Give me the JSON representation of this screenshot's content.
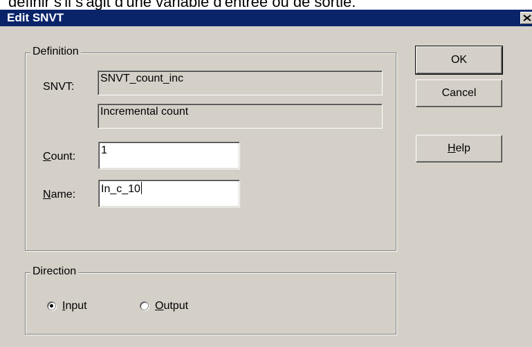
{
  "background_text": "définir s'il s'agit d'une variable d'entrée ou de sortie.",
  "dialog": {
    "title": "Edit SNVT",
    "buttons": {
      "ok": "OK",
      "cancel": "Cancel",
      "help_mnemonic": "H",
      "help_rest": "elp"
    }
  },
  "definition": {
    "legend": "Definition",
    "snvt_label": "SNVT:",
    "snvt_name": "SNVT_count_inc",
    "snvt_description": "Incremental count",
    "count_label_mnemonic": "C",
    "count_label_rest": "ount:",
    "count_value": "1",
    "name_label_mnemonic": "N",
    "name_label_rest": "ame:",
    "name_value": "In_c_10"
  },
  "direction": {
    "legend": "Direction",
    "options": [
      {
        "mnemonic": "I",
        "rest": "nput",
        "selected": true
      },
      {
        "mnemonic": "O",
        "rest": "utput",
        "selected": false
      }
    ]
  },
  "colors": {
    "title_bar": "#0a246a",
    "dialog_face": "#d4d0c8"
  }
}
